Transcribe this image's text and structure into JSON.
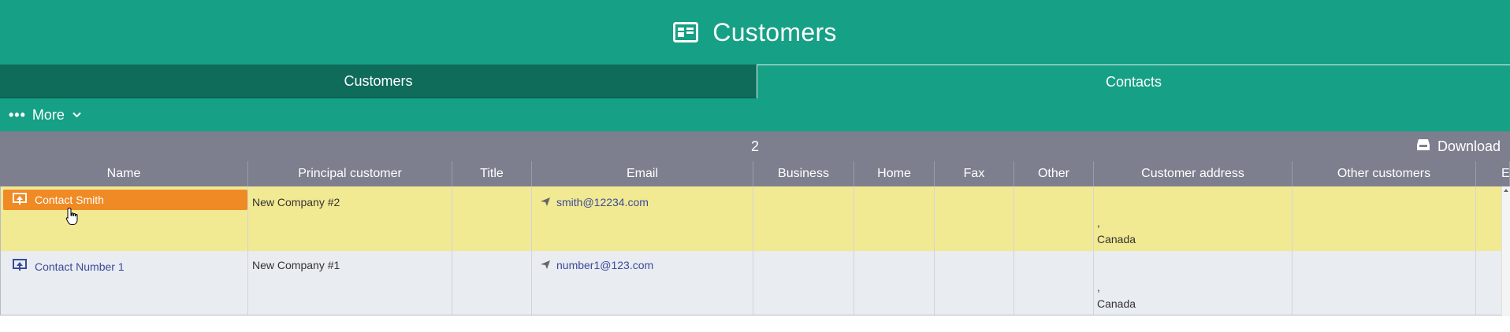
{
  "header": {
    "title": "Customers",
    "icon": "contact-card-icon"
  },
  "tabs": [
    {
      "label": "Customers",
      "active": true
    },
    {
      "label": "Contacts",
      "active": false
    }
  ],
  "more_menu": {
    "label": "More",
    "icon": "more-dots-icon"
  },
  "grid": {
    "count": "2",
    "download_label": "Download",
    "columns": [
      "Name",
      "Principal customer",
      "Title",
      "Email",
      "Business",
      "Home",
      "Fax",
      "Other",
      "Customer address",
      "Other customers",
      "E"
    ],
    "rows": [
      {
        "name": "Contact Smith",
        "principal_customer": "New Company #2",
        "title": "",
        "email": "smith@12234.com",
        "business": "",
        "home": "",
        "fax": "",
        "other": "",
        "address_line": ",",
        "address_country": "Canada",
        "other_customers": "",
        "selected": true
      },
      {
        "name": "Contact Number 1",
        "principal_customer": "New Company #1",
        "title": "",
        "email": "number1@123.com",
        "business": "",
        "home": "",
        "fax": "",
        "other": "",
        "address_line": ",",
        "address_country": "Canada",
        "other_customers": "",
        "selected": false
      }
    ]
  },
  "colors": {
    "header": "#16a085",
    "active_tab": "#0f6b5a",
    "grid_header": "#7d7f8e",
    "selected_row": "#f2e993",
    "row": "#e9ecf0",
    "name_chip": "#f08a24",
    "link": "#3b4a9a"
  }
}
